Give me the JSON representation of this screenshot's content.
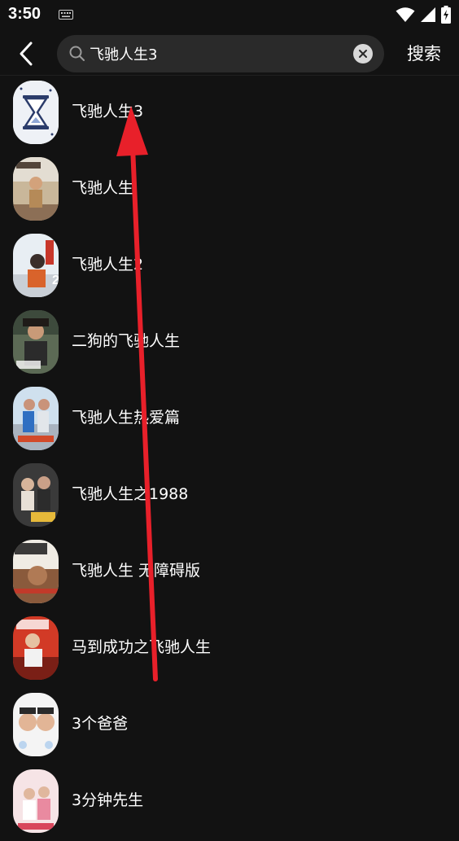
{
  "status_bar": {
    "time": "3:50",
    "icons": [
      "keyboard-icon",
      "wifi-icon",
      "signal-icon",
      "battery-charging-icon"
    ]
  },
  "search": {
    "back_icon": "chevron-left-icon",
    "search_icon": "search-icon",
    "value": "飞驰人生3",
    "clear_icon": "close-icon",
    "submit_label": "搜索"
  },
  "results": [
    {
      "title": "飞驰人生3",
      "thumb": "hourglass-placeholder"
    },
    {
      "title": "飞驰人生",
      "thumb": "poster"
    },
    {
      "title": "飞驰人生2",
      "thumb": "poster"
    },
    {
      "title": "二狗的飞驰人生",
      "thumb": "poster"
    },
    {
      "title": "飞驰人生热爱篇",
      "thumb": "poster"
    },
    {
      "title": "飞驰人生之1988",
      "thumb": "poster"
    },
    {
      "title": "飞驰人生 无障碍版",
      "thumb": "poster"
    },
    {
      "title": "马到成功之飞驰人生",
      "thumb": "poster"
    },
    {
      "title": "3个爸爸",
      "thumb": "poster"
    },
    {
      "title": "3分钟先生",
      "thumb": "poster"
    }
  ],
  "colors": {
    "background": "#121212",
    "search_box": "#2a2a2a",
    "text": "#ffffff",
    "annotation_arrow": "#e8202a"
  }
}
